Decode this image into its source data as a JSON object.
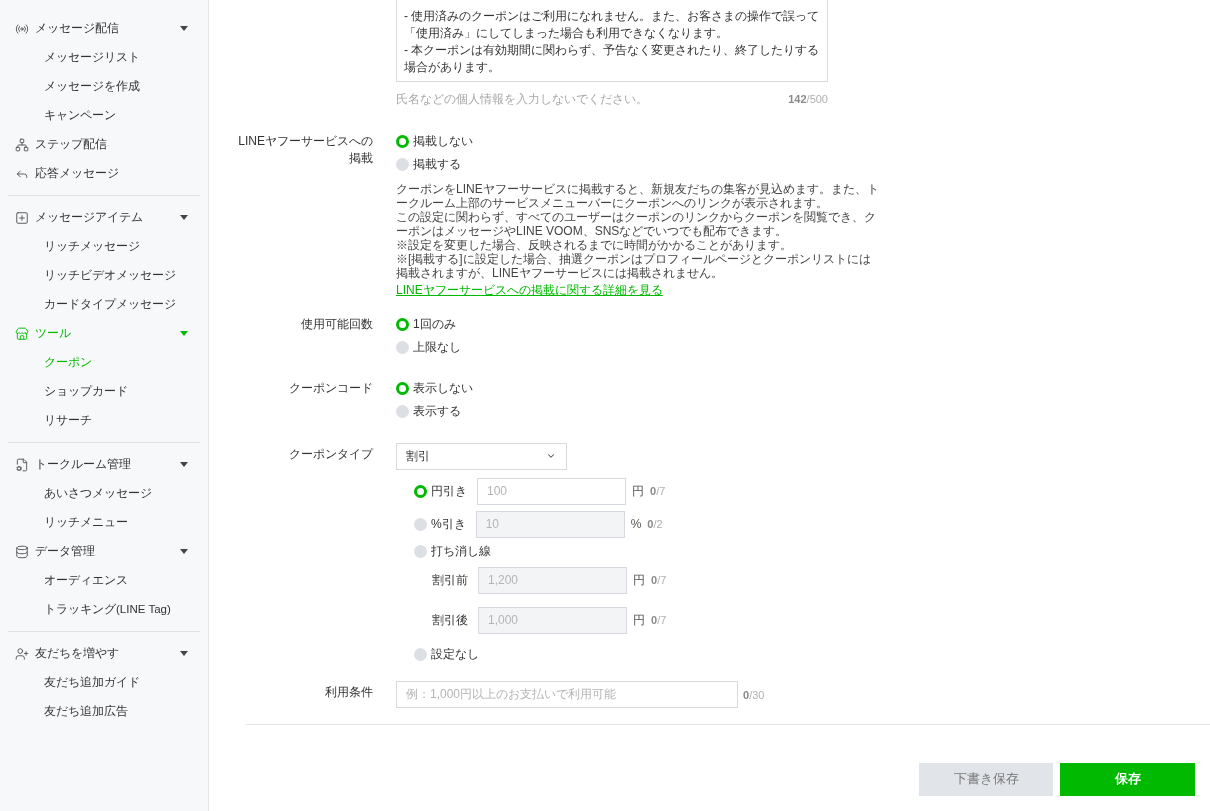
{
  "sidebar": {
    "sections": [
      {
        "items": [
          {
            "label": "メッセージ配信",
            "selected": false,
            "expanded": true,
            "children": [
              {
                "label": "メッセージリスト",
                "selected": false
              },
              {
                "label": "メッセージを作成",
                "selected": false
              },
              {
                "label": "キャンペーン",
                "selected": false
              }
            ]
          },
          {
            "label": "ステップ配信",
            "selected": false
          },
          {
            "label": "応答メッセージ",
            "selected": false
          }
        ]
      },
      {
        "items": [
          {
            "label": "メッセージアイテム",
            "selected": false,
            "expanded": true,
            "children": [
              {
                "label": "リッチメッセージ",
                "selected": false
              },
              {
                "label": "リッチビデオメッセージ",
                "selected": false
              },
              {
                "label": "カードタイプメッセージ",
                "selected": false
              }
            ]
          },
          {
            "label": "ツール",
            "selected": true,
            "expanded": true,
            "children": [
              {
                "label": "クーポン",
                "selected": true
              },
              {
                "label": "ショップカード",
                "selected": false
              },
              {
                "label": "リサーチ",
                "selected": false
              }
            ]
          }
        ]
      },
      {
        "items": [
          {
            "label": "トークルーム管理",
            "selected": false,
            "expanded": true,
            "children": [
              {
                "label": "あいさつメッセージ",
                "selected": false
              },
              {
                "label": "リッチメニュー",
                "selected": false
              }
            ]
          },
          {
            "label": "データ管理",
            "selected": false,
            "expanded": true,
            "children": [
              {
                "label": "オーディエンス",
                "selected": false
              },
              {
                "label": "トラッキング(LINE Tag)",
                "selected": false
              }
            ]
          }
        ]
      },
      {
        "items": [
          {
            "label": "友だちを増やす",
            "selected": false,
            "expanded": true,
            "children": [
              {
                "label": "友だち追加ガイド",
                "selected": false
              },
              {
                "label": "友だち追加広告",
                "selected": false
              }
            ]
          }
        ]
      }
    ]
  },
  "form": {
    "usage_guide": {
      "value": "- 使用済みのクーポンはご利用になれません。また、お客さまの操作で誤って「使用済み」にしてしまった場合も利用できなくなります。\n- 本クーポンは有効期間に関わらず、予告なく変更されたり、終了したりする場合があります。",
      "hint": "氏名などの個人情報を入力しないでください。",
      "counter": "**142**/500"
    },
    "line_yahoo_listing": {
      "label": "LINEヤフーサービスへの掲載",
      "options": [
        {
          "label": "掲載しない",
          "selected": true
        },
        {
          "label": "掲載する",
          "selected": false
        }
      ],
      "notes": [
        "クーポンをLINEヤフーサービスに掲載すると、新規友だちの集客が見込めます。また、トークルーム上部のサービスメニューバーにクーポンへのリンクが表示されます。",
        "この設定に関わらず、すべてのユーザーはクーポンのリンクからクーポンを閲覧でき、クーポンはメッセージやLINE VOOM、SNSなどでいつでも配布できます。",
        "※設定を変更した場合、反映されるまでに時間がかかることがあります。",
        "※[掲載する]に設定した場合、抽選クーポンはプロフィールページとクーポンリストには掲載されますが、LINEヤフーサービスには掲載されません。"
      ],
      "link": "LINEヤフーサービスへの掲載に関する詳細を見る"
    },
    "usage_count": {
      "label": "使用可能回数",
      "options": [
        {
          "label": "1回のみ",
          "selected": true
        },
        {
          "label": "上限なし",
          "selected": false
        }
      ]
    },
    "coupon_code": {
      "label": "クーポンコード",
      "options": [
        {
          "label": "表示しない",
          "selected": true
        },
        {
          "label": "表示する",
          "selected": false
        }
      ]
    },
    "coupon_type": {
      "label": "クーポンタイプ",
      "select": {
        "value": "割引"
      },
      "options": [
        {
          "kind": "amount",
          "label": "円引き",
          "selected": true,
          "field": {
            "placeholder": "100",
            "disabled": false
          },
          "unit": "円",
          "counter": "**0**/7"
        },
        {
          "kind": "amount",
          "label": "%引き",
          "selected": false,
          "field": {
            "placeholder": "10",
            "disabled": true
          },
          "unit": "%",
          "counter": "**0**/2"
        },
        {
          "kind": "strikethrough",
          "label": "打ち消し線",
          "selected": false,
          "rows": [
            {
              "label": "割引前",
              "field": {
                "placeholder": "1,200",
                "disabled": true
              },
              "unit": "円",
              "counter": "**0**/7"
            },
            {
              "label": "割引後",
              "field": {
                "placeholder": "1,000",
                "disabled": true
              },
              "unit": "円",
              "counter": "**0**/7"
            }
          ]
        },
        {
          "kind": "plain",
          "label": "設定なし",
          "selected": false
        }
      ]
    },
    "conditions": {
      "label": "利用条件",
      "field": {
        "placeholder": "例：1,000円以上のお支払いで利用可能"
      },
      "counter": "**0**/30"
    }
  },
  "buttons": [
    {
      "label": "下書き保存",
      "kind": "secondary"
    },
    {
      "label": "保存",
      "kind": "primary"
    }
  ]
}
